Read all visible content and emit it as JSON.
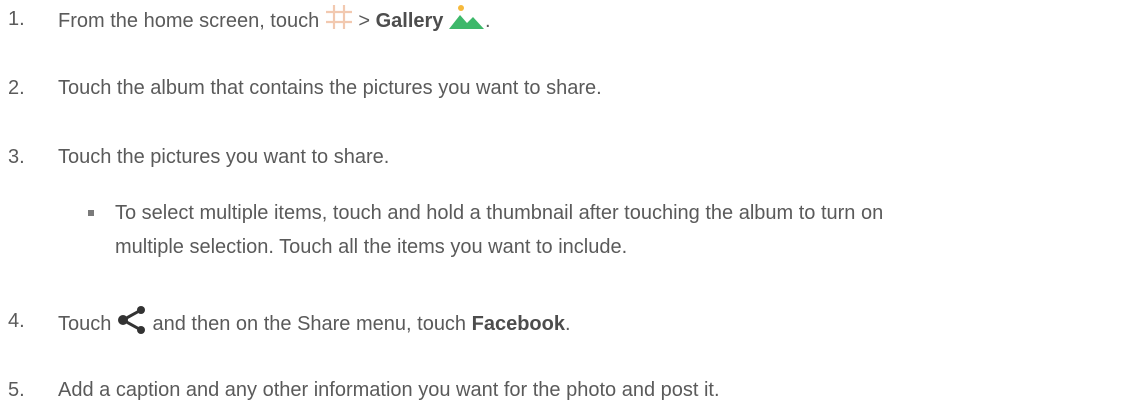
{
  "steps": {
    "s1": {
      "number": "1.",
      "before_icon": "From the home screen, touch ",
      "gt": " > ",
      "gallery": "Gallery",
      "period": ".",
      "apps_icon": "apps-grid-icon",
      "gallery_icon": "gallery-icon"
    },
    "s2": {
      "number": "2.",
      "text": "Touch the album that contains the pictures you want to share."
    },
    "s3": {
      "number": "3.",
      "text": "Touch the pictures you want to share.",
      "bullet_line1": "To select multiple items, touch and hold a thumbnail after touching the album to turn on",
      "bullet_line2": "multiple selection. Touch all the items you want to include."
    },
    "s4": {
      "number": "4.",
      "touch": "Touch ",
      "after_icon": " and then on the Share menu, touch ",
      "facebook": "Facebook",
      "period": ".",
      "share_icon": "share-icon"
    },
    "s5": {
      "number": "5.",
      "text": "Add a caption and any other information you want for the photo and post it."
    }
  },
  "colors": {
    "text": "#5a5a5a",
    "apps_icon": "#f2c9b0",
    "gallery_green": "#3db86a",
    "gallery_sun": "#f6b93b",
    "share_icon": "#333333"
  }
}
